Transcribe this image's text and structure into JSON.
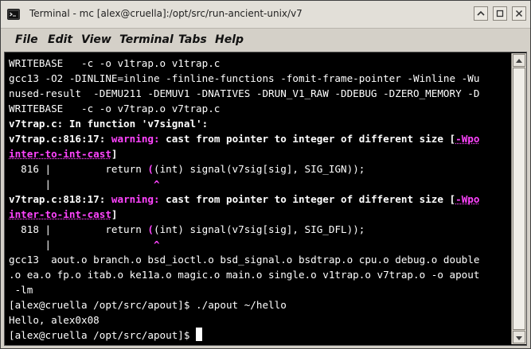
{
  "window": {
    "title": "Terminal - mc [alex@cruella]:/opt/src/run-ancient-unix/v7"
  },
  "menubar": {
    "items": [
      "File",
      "Edit",
      "View",
      "Terminal",
      "Tabs",
      "Help"
    ]
  },
  "terminal": {
    "lines": [
      "WRITEBASE   -c -o v1trap.o v1trap.c",
      "gcc13 -O2 -DINLINE=inline -finline-functions -fomit-frame-pointer -Winline -Wu",
      "nused-result  -DEMU211 -DEMUV1 -DNATIVES -DRUN_V1_RAW -DDEBUG -DZERO_MEMORY -D",
      "WRITEBASE   -c -o v7trap.o v7trap.c",
      "v7trap.c: In function 'v7signal':",
      [
        "v7trap.c:816:17: ",
        "warning:",
        " cast from pointer to integer of different size [",
        "-Wpo"
      ],
      [
        "inter-to-int-cast",
        "]"
      ],
      [
        "  816 |         return ",
        "(",
        "(int) signal(v7sig[sig], SIG_IGN));"
      ],
      [
        "      |                 ",
        "^"
      ],
      [
        "v7trap.c:818:17: ",
        "warning:",
        " cast from pointer to integer of different size [",
        "-Wpo"
      ],
      [
        "inter-to-int-cast",
        "]"
      ],
      [
        "  818 |         return ",
        "(",
        "(int) signal(v7sig[sig], SIG_DFL));"
      ],
      [
        "      |                 ",
        "^"
      ],
      "gcc13  aout.o branch.o bsd_ioctl.o bsd_signal.o bsdtrap.o cpu.o debug.o double",
      ".o ea.o fp.o itab.o ke11a.o magic.o main.o single.o v1trap.o v7trap.o -o apout",
      " -lm",
      "[alex@cruella /opt/src/apout]$ ./apout ~/hello",
      "Hello, alex0x08",
      "[alex@cruella /opt/src/apout]$ "
    ]
  },
  "icons": {
    "app": "terminal-icon",
    "up": "chevron-up-icon",
    "maximize": "maximize-icon",
    "close": "close-icon"
  },
  "colors": {
    "background": "#000000",
    "foreground": "#ffffff",
    "highlight": "#ff44ff"
  }
}
